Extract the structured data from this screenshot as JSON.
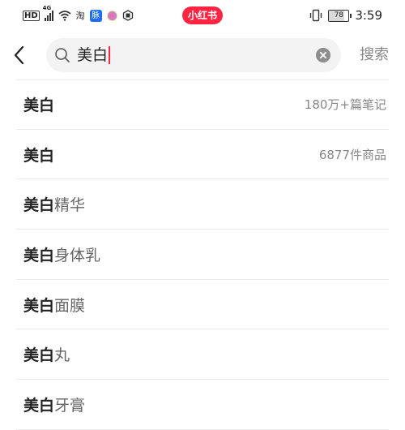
{
  "status_bar": {
    "hd": "HD",
    "network": "4G",
    "taobao": "淘",
    "blue_app": "脉",
    "brand": "小红书",
    "battery": "78",
    "battery_level": 0.78,
    "time": "3:59"
  },
  "search": {
    "query": "美白",
    "search_label": "搜索"
  },
  "suggestions": [
    {
      "keyword": "美白",
      "rest": "",
      "meta": "180万+篇笔记"
    },
    {
      "keyword": "美白",
      "rest": "",
      "meta": "6877件商品"
    },
    {
      "keyword": "美白",
      "rest": "精华",
      "meta": ""
    },
    {
      "keyword": "美白",
      "rest": "身体乳",
      "meta": ""
    },
    {
      "keyword": "美白",
      "rest": "面膜",
      "meta": ""
    },
    {
      "keyword": "美白",
      "rest": "丸",
      "meta": ""
    },
    {
      "keyword": "美白",
      "rest": "牙膏",
      "meta": ""
    }
  ],
  "colors": {
    "brand_red": "#ff2442",
    "search_bg": "#f3f3f3",
    "muted_text": "#888888"
  }
}
